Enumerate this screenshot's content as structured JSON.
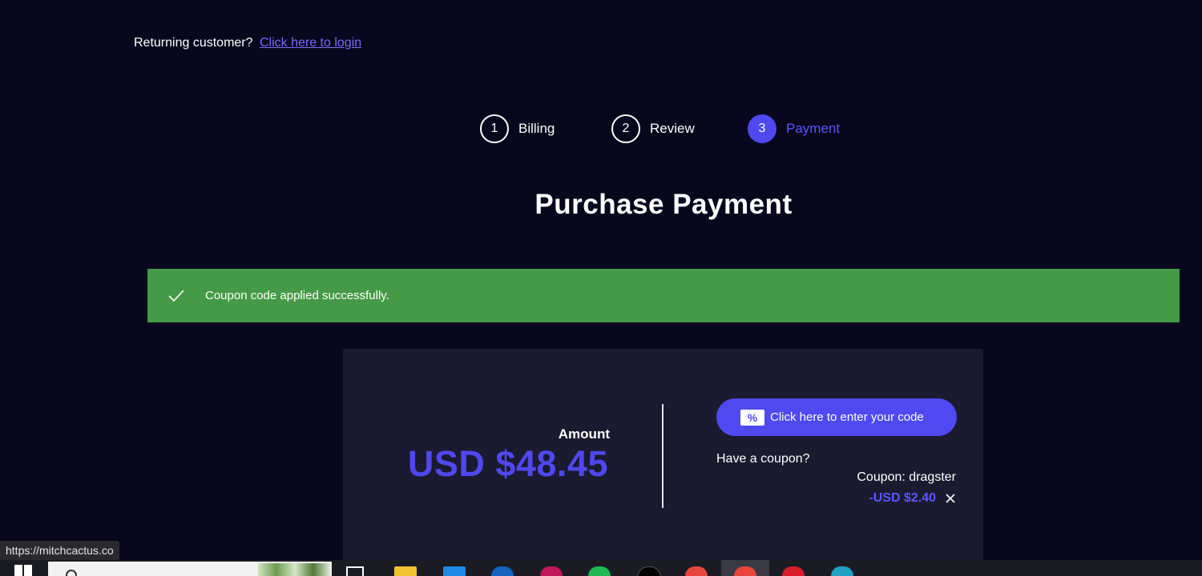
{
  "header": {
    "returning_text": "Returning customer?",
    "login_link": "Click here to login"
  },
  "steps": [
    {
      "number": "1",
      "label": "Billing",
      "active": false
    },
    {
      "number": "2",
      "label": "Review",
      "active": false
    },
    {
      "number": "3",
      "label": "Payment",
      "active": true
    }
  ],
  "page_title": "Purchase Payment",
  "alert": {
    "message": "Coupon code applied successfully.",
    "color": "#459a47",
    "icon": "check-icon"
  },
  "payment": {
    "amount_label": "Amount",
    "amount_value": "USD $48.45",
    "code_button_label": "Click here to enter your code",
    "code_button_icon_text": "%",
    "have_coupon": "Have a coupon?",
    "coupon_name": "Coupon: dragster",
    "coupon_discount": "-USD $2.40",
    "accent_color": "#4e49f0"
  },
  "status_bar": {
    "url": "https://mitchcactus.co"
  },
  "taskbar": {
    "icons": [
      "windows-start-icon",
      "search-icon",
      "task-view-icon",
      "file-explorer-icon",
      "store-icon",
      "mail-icon",
      "app-icon",
      "spotify-icon",
      "tiktok-icon",
      "chrome-icon",
      "chrome-icon",
      "opera-icon",
      "edge-icon"
    ]
  }
}
